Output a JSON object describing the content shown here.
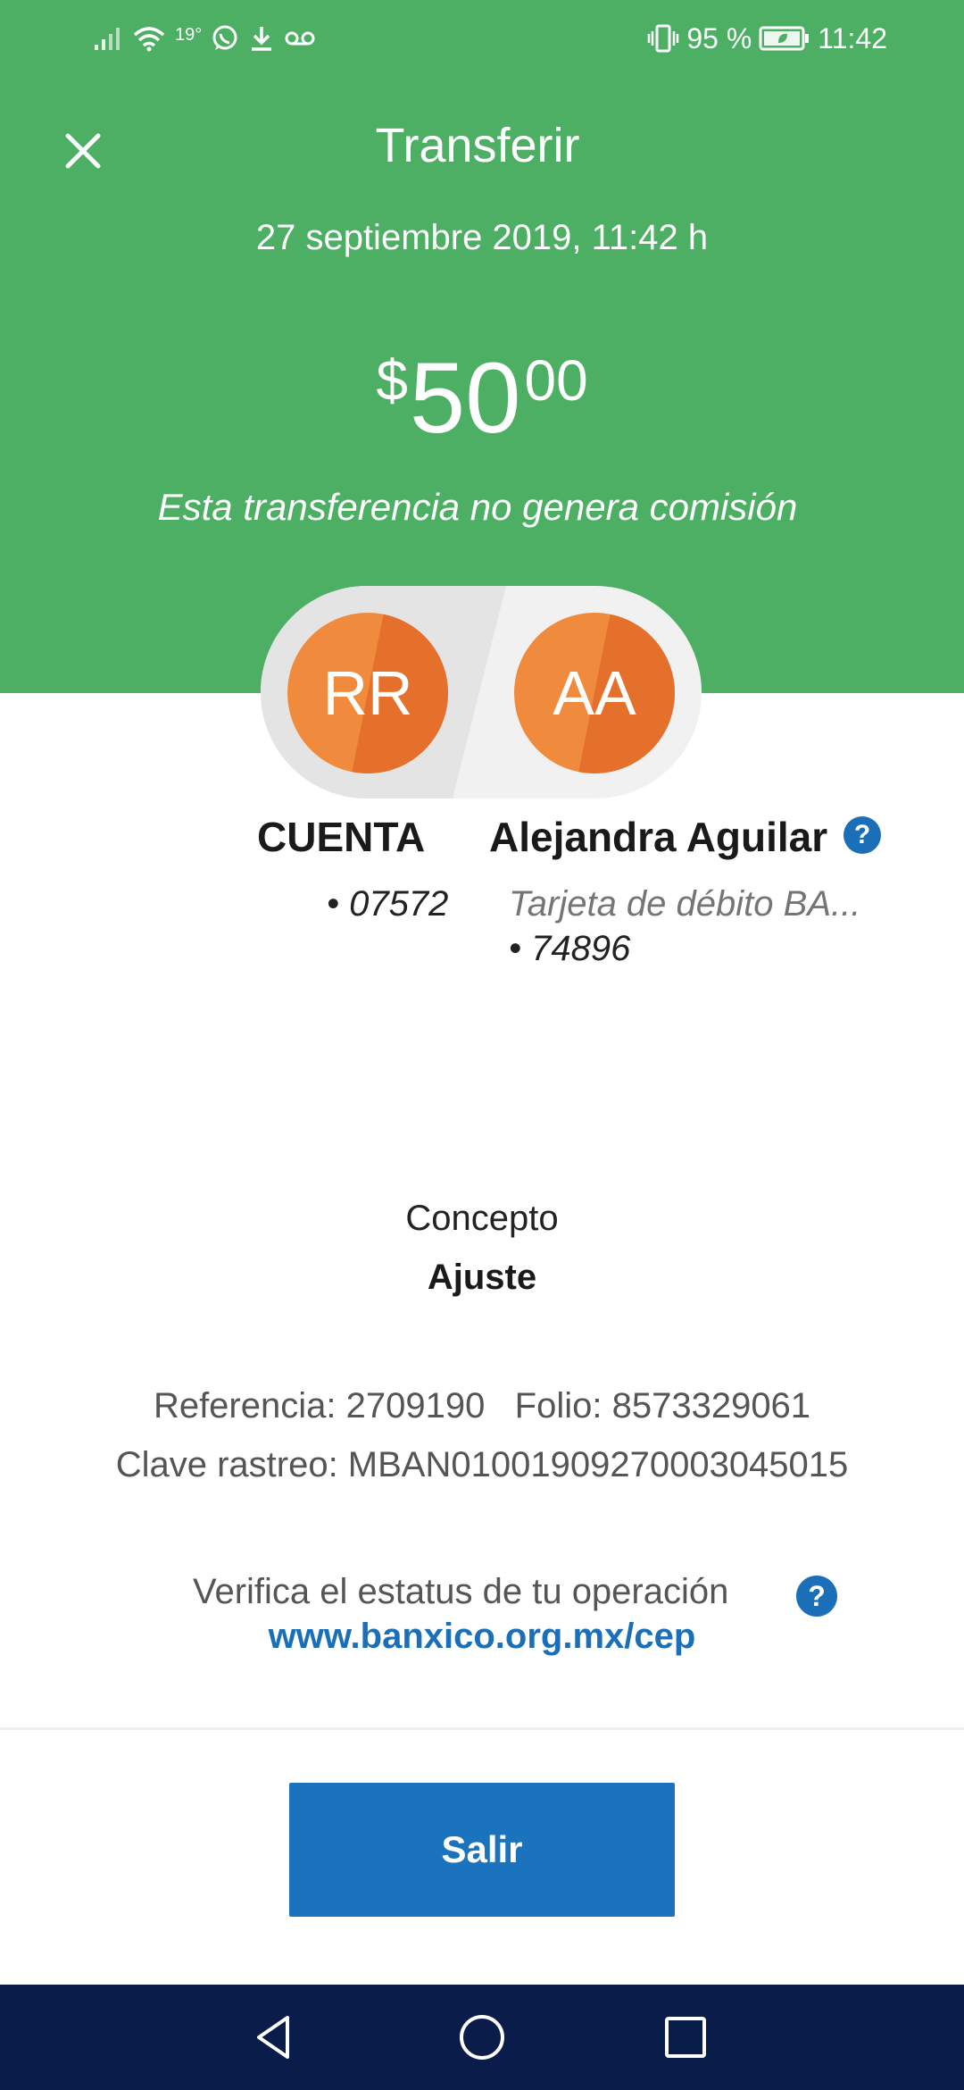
{
  "status_bar": {
    "temperature": "19°",
    "battery_percent": "95 %",
    "time": "11:42",
    "icons": [
      "signal-icon",
      "wifi-icon",
      "whatsapp-icon",
      "download-icon",
      "voicemail-icon",
      "vibrate-icon",
      "battery-icon"
    ]
  },
  "header": {
    "title": "Transferir",
    "date": "27 septiembre 2019, 11:42 h",
    "amount": {
      "currency": "$",
      "integer": "50",
      "decimals": "00"
    },
    "commission_note": "Esta transferencia no genera comisión"
  },
  "from": {
    "initials": "RR",
    "name": "CUENTA",
    "account": "• 07572"
  },
  "to": {
    "initials": "AA",
    "name": "Alejandra Aguilar",
    "card": "Tarjeta de débito BA...",
    "account": "• 74896"
  },
  "concept": {
    "label": "Concepto",
    "value": "Ajuste"
  },
  "references": {
    "line": "Referencia: 2709190   Folio: 8573329061",
    "tracking": "Clave rastreo: MBAN01001909270003045015"
  },
  "verify": {
    "text": "Verifica el estatus de tu operación",
    "link": "www.banxico.org.mx/cep",
    "help_glyph": "?"
  },
  "actions": {
    "exit_label": "Salir"
  },
  "colors": {
    "header_green": "#4caf63",
    "avatar_orange": "#f08a3c",
    "accent_blue": "#1b73bd",
    "nav_bar": "#0a1c4a"
  }
}
